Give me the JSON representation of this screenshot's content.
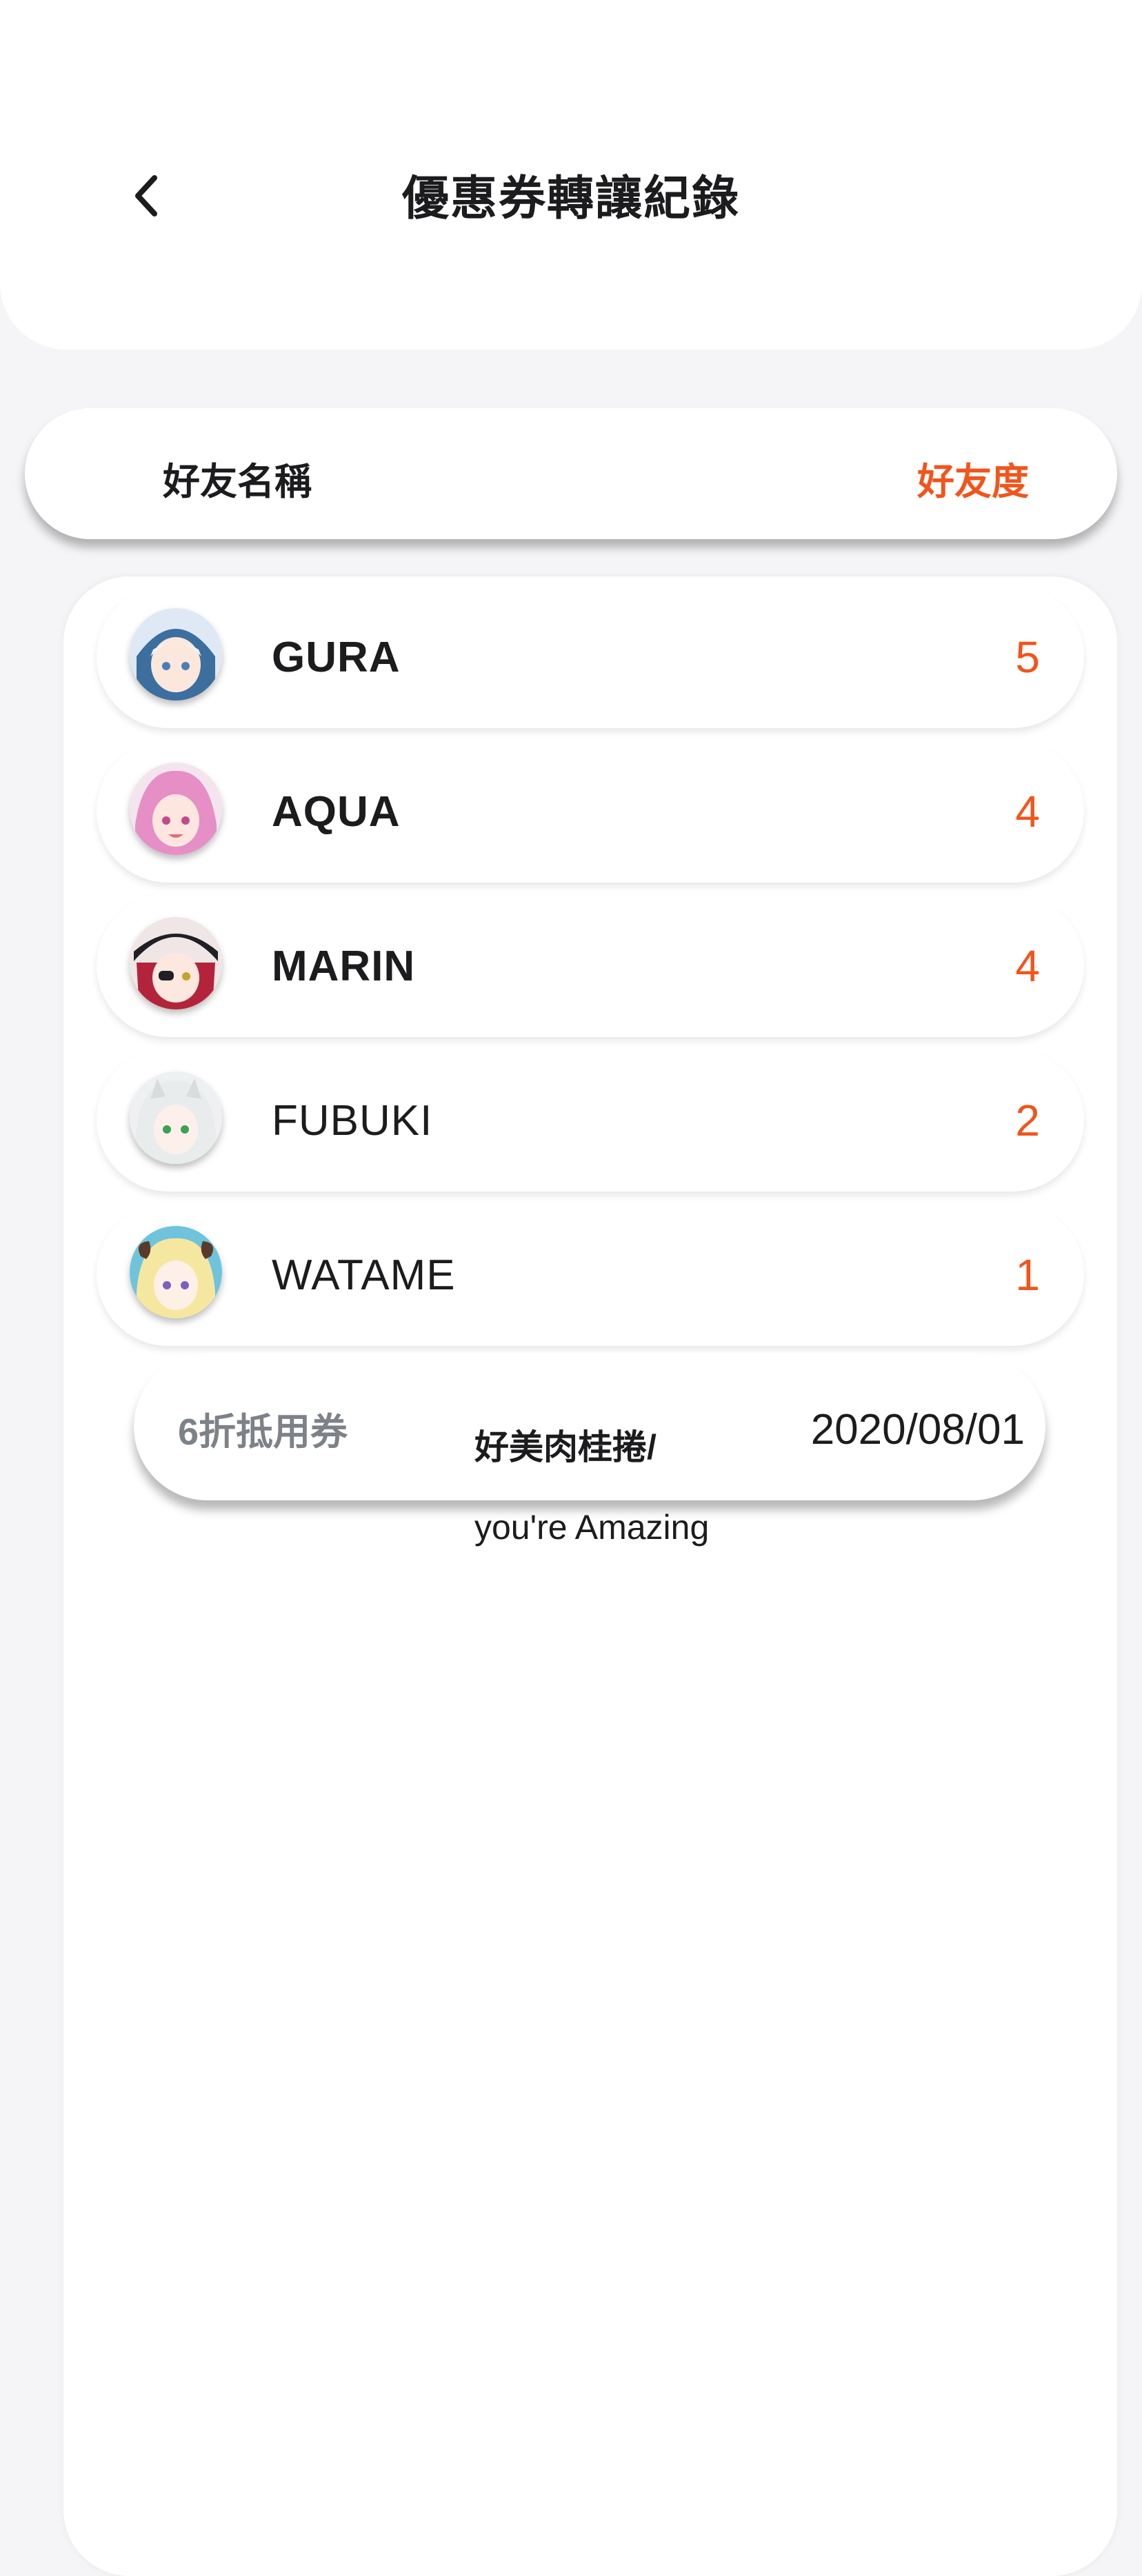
{
  "header": {
    "title": "優惠券轉讓紀錄",
    "back_icon": "chevron-left-icon"
  },
  "columns": {
    "name_label": "好友名稱",
    "score_label": "好友度"
  },
  "colors": {
    "accent": "#f2541b",
    "muted": "#7d8188",
    "text": "#1c1c1e"
  },
  "friends": [
    {
      "name": "GURA",
      "score": "5"
    },
    {
      "name": "AQUA",
      "score": "4"
    },
    {
      "name": "MARIN",
      "score": "4"
    },
    {
      "name": "FUBUKI",
      "score": "2"
    },
    {
      "name": "WATAME",
      "score": "1"
    }
  ],
  "coupon": {
    "type": "6折抵用券",
    "shop_line1": "好美肉桂捲/",
    "shop_line2": "you're Amazing",
    "date": "2020/08/01"
  }
}
